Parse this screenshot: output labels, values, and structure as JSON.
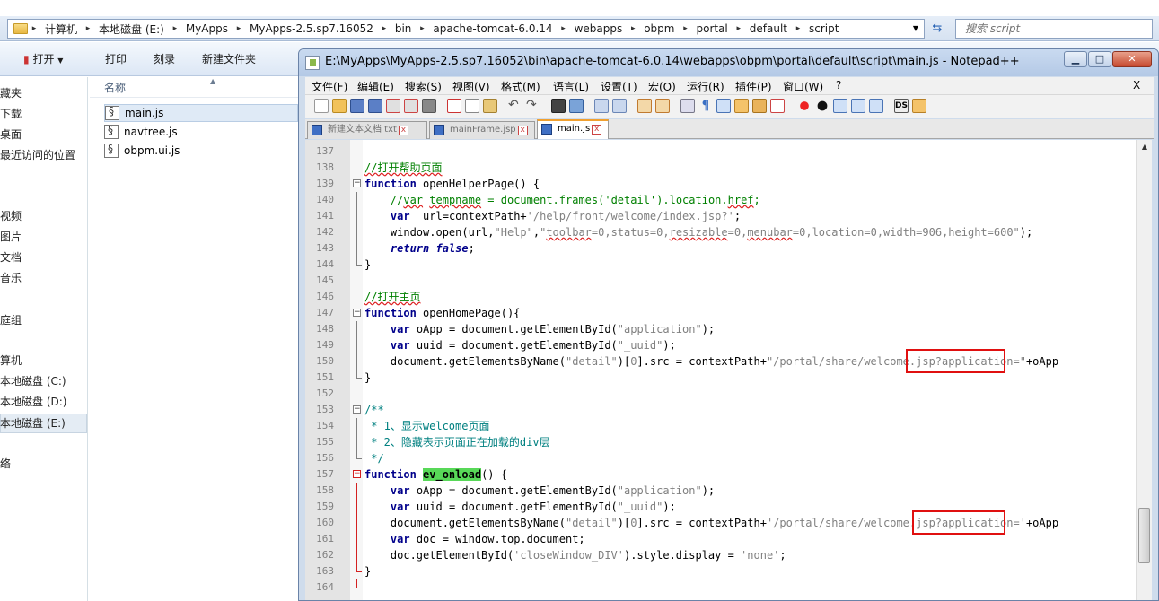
{
  "explorer": {
    "breadcrumbs": [
      "计算机",
      "本地磁盘 (E:)",
      "MyApps",
      "MyApps-2.5.sp7.16052",
      "bin",
      "apache-tomcat-6.0.14",
      "webapps",
      "obpm",
      "portal",
      "default",
      "script"
    ],
    "search_placeholder": "搜索 script",
    "toolbar": {
      "open": "打开",
      "print": "打印",
      "burn": "刻录",
      "new_folder": "新建文件夹"
    },
    "nav_items": [
      "藏夹",
      "下载",
      "桌面",
      "最近访问的位置",
      "视频",
      "图片",
      "文档",
      "音乐",
      "庭组",
      "算机",
      "本地磁盘 (C:)",
      "本地磁盘 (D:)",
      "本地磁盘 (E:)",
      "络"
    ],
    "column_name": "名称",
    "files": [
      "main.js",
      "navtree.js",
      "obpm.ui.js"
    ]
  },
  "notepad": {
    "title": "E:\\MyApps\\MyApps-2.5.sp7.16052\\bin\\apache-tomcat-6.0.14\\webapps\\obpm\\portal\\default\\script\\main.js - Notepad++",
    "menus": [
      "文件(F)",
      "编辑(E)",
      "搜索(S)",
      "视图(V)",
      "格式(M)",
      "语言(L)",
      "设置(T)",
      "宏(O)",
      "运行(R)",
      "插件(P)",
      "窗口(W)",
      "?"
    ],
    "menu_close": "X",
    "tabs": [
      "新建文本文档 txt",
      "mainFrame.jsp",
      "main.js"
    ],
    "window_buttons": {
      "minimize": "▁",
      "maximize": "□",
      "close": "✕"
    },
    "code": {
      "l137": "",
      "l138": "//打开帮助页面",
      "l139a": "function",
      "l139b": " openHelperPage() {",
      "l140a": "    //",
      "l140b": "var",
      "l140c": " ",
      "l140d": "tempname",
      "l140e": " = document.frames('detail').location.",
      "l140f": "href",
      "l140g": ";",
      "l141a": "    ",
      "l141b": "var",
      "l141c": "  url=contextPath+",
      "l141d": "'/help/front/welcome/index.jsp?'",
      "l141e": ";",
      "l142a": "    window.open(url,",
      "l142b": "\"Help\"",
      "l142c": ",",
      "l142d": "\"",
      "l142e": "toolbar",
      "l142f": "=0,status=0,",
      "l142g": "resizable",
      "l142h": "=0,",
      "l142i": "menubar",
      "l142j": "=0,location=0,width=906,height=600\"",
      "l142k": ");",
      "l143a": "    ",
      "l143b": "return",
      "l143c": " ",
      "l143d": "false",
      "l143e": ";",
      "l144": "}",
      "l146": "//打开主页",
      "l147a": "function",
      "l147b": " openHomePage(){",
      "l148a": "    ",
      "l148b": "var",
      "l148c": " oApp = document.getElementById(",
      "l148d": "\"application\"",
      "l148e": ");",
      "l149a": "    ",
      "l149b": "var",
      "l149c": " uuid = document.getElementById(",
      "l149d": "\"_uuid\"",
      "l149e": ");",
      "l150a": "    document.getElementsByName(",
      "l150b": "\"detail\"",
      "l150c": ")[",
      "l150d": "0",
      "l150e": "].src = contextPath+",
      "l150f": "\"/portal/share/welcome.jsp?application=\"",
      "l150g": "+oApp",
      "l151": "}",
      "l153": "/**",
      "l154": " * 1、显示welcome页面",
      "l155": " * 2、隐藏表示页面正在加载的div层",
      "l156": " */",
      "l157a": "function",
      "l157b": " ",
      "l157c": "ev_onload",
      "l157d": "() {",
      "l158a": "    ",
      "l158b": "var",
      "l158c": " oApp = document.getElementById(",
      "l158d": "\"application\"",
      "l158e": ");",
      "l159a": "    ",
      "l159b": "var",
      "l159c": " uuid = document.getElementById(",
      "l159d": "\"_uuid\"",
      "l159e": ");",
      "l160a": "    document.getElementsByName(",
      "l160b": "\"detail\"",
      "l160c": ")[",
      "l160d": "0",
      "l160e": "].src = contextPath+",
      "l160f": "'/portal/share/welcome.jsp?application='",
      "l160g": "+oApp",
      "l161a": "    ",
      "l161b": "var",
      "l161c": " doc = window.top.document;",
      "l162a": "    doc.getElementById(",
      "l162b": "'closeWindow_DIV'",
      "l162c": ").style.display = ",
      "l162d": "'none'",
      "l162e": ";",
      "l163": "}",
      "l164": ""
    },
    "line_numbers": [
      "137",
      "138",
      "139",
      "140",
      "141",
      "142",
      "143",
      "144",
      "145",
      "146",
      "147",
      "148",
      "149",
      "150",
      "151",
      "152",
      "153",
      "154",
      "155",
      "156",
      "157",
      "158",
      "159",
      "160",
      "161",
      "162",
      "163",
      "164"
    ]
  }
}
